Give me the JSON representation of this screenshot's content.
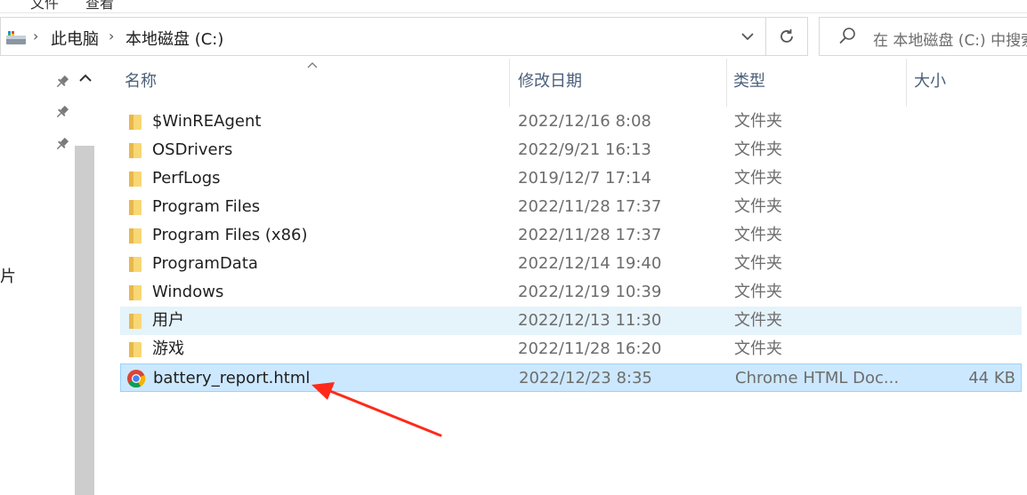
{
  "ribbon": {
    "fragments": [
      "文件",
      "查看"
    ]
  },
  "address_bar": {
    "crumbs": [
      "此电脑",
      "本地磁盘 (C:)"
    ],
    "search_placeholder": "在 本地磁盘 (C:) 中搜索"
  },
  "nav_pane": {
    "partial_label": "片"
  },
  "columns": {
    "name": "名称",
    "date": "修改日期",
    "type": "类型",
    "size": "大小"
  },
  "rows": [
    {
      "name": "$WinREAgent",
      "date": "2022/12/16 8:08",
      "type": "文件夹",
      "size": "",
      "icon": "folder-icon",
      "state": "normal"
    },
    {
      "name": "OSDrivers",
      "date": "2022/9/21 16:13",
      "type": "文件夹",
      "size": "",
      "icon": "folder-icon",
      "state": "normal"
    },
    {
      "name": "PerfLogs",
      "date": "2019/12/7 17:14",
      "type": "文件夹",
      "size": "",
      "icon": "folder-icon",
      "state": "normal"
    },
    {
      "name": "Program Files",
      "date": "2022/11/28 17:37",
      "type": "文件夹",
      "size": "",
      "icon": "folder-icon",
      "state": "normal"
    },
    {
      "name": "Program Files (x86)",
      "date": "2022/11/28 17:37",
      "type": "文件夹",
      "size": "",
      "icon": "folder-icon",
      "state": "normal"
    },
    {
      "name": "ProgramData",
      "date": "2022/12/14 19:40",
      "type": "文件夹",
      "size": "",
      "icon": "folder-icon",
      "state": "normal"
    },
    {
      "name": "Windows",
      "date": "2022/12/19 10:39",
      "type": "文件夹",
      "size": "",
      "icon": "folder-icon",
      "state": "normal"
    },
    {
      "name": "用户",
      "date": "2022/12/13 11:30",
      "type": "文件夹",
      "size": "",
      "icon": "folder-icon",
      "state": "hover"
    },
    {
      "name": "游戏",
      "date": "2022/11/28 16:20",
      "type": "文件夹",
      "size": "",
      "icon": "folder-icon",
      "state": "normal"
    },
    {
      "name": "battery_report.html",
      "date": "2022/12/23 8:35",
      "type": "Chrome HTML Doc...",
      "size": "44 KB",
      "icon": "chrome-icon",
      "state": "selected"
    }
  ],
  "colors": {
    "hover_row": "#e5f3fb",
    "selected_row": "#cce8ff",
    "header_text": "#4c607a",
    "folder": "#f8d775",
    "arrow": "#ff2a1a"
  }
}
